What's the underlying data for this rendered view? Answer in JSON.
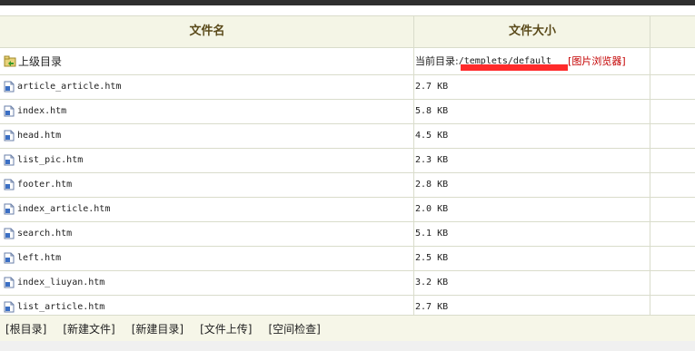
{
  "table": {
    "columns": [
      "文件名",
      "文件大小"
    ],
    "parent": {
      "label": "上级目录",
      "current_dir_label": "当前目录:",
      "current_dir_path": "/templets/default",
      "image_browser_label": "[图片浏览器]"
    },
    "files": [
      {
        "name": "article_article.htm",
        "size": "2.7 KB"
      },
      {
        "name": "index.htm",
        "size": "5.8 KB"
      },
      {
        "name": "head.htm",
        "size": "4.5 KB"
      },
      {
        "name": "list_pic.htm",
        "size": "2.3 KB"
      },
      {
        "name": "footer.htm",
        "size": "2.8 KB"
      },
      {
        "name": "index_article.htm",
        "size": "2.0 KB"
      },
      {
        "name": "search.htm",
        "size": "5.1 KB"
      },
      {
        "name": "left.htm",
        "size": "2.5 KB"
      },
      {
        "name": "index_liuyan.htm",
        "size": "3.2 KB"
      },
      {
        "name": "list_article.htm",
        "size": "2.7 KB"
      }
    ]
  },
  "footer": {
    "links": [
      "[根目录]",
      "[新建文件]",
      "[新建目录]",
      "[文件上传]",
      "[空间检查]"
    ]
  },
  "icons": {
    "parent": "folder-up-icon",
    "file": "file-icon"
  }
}
